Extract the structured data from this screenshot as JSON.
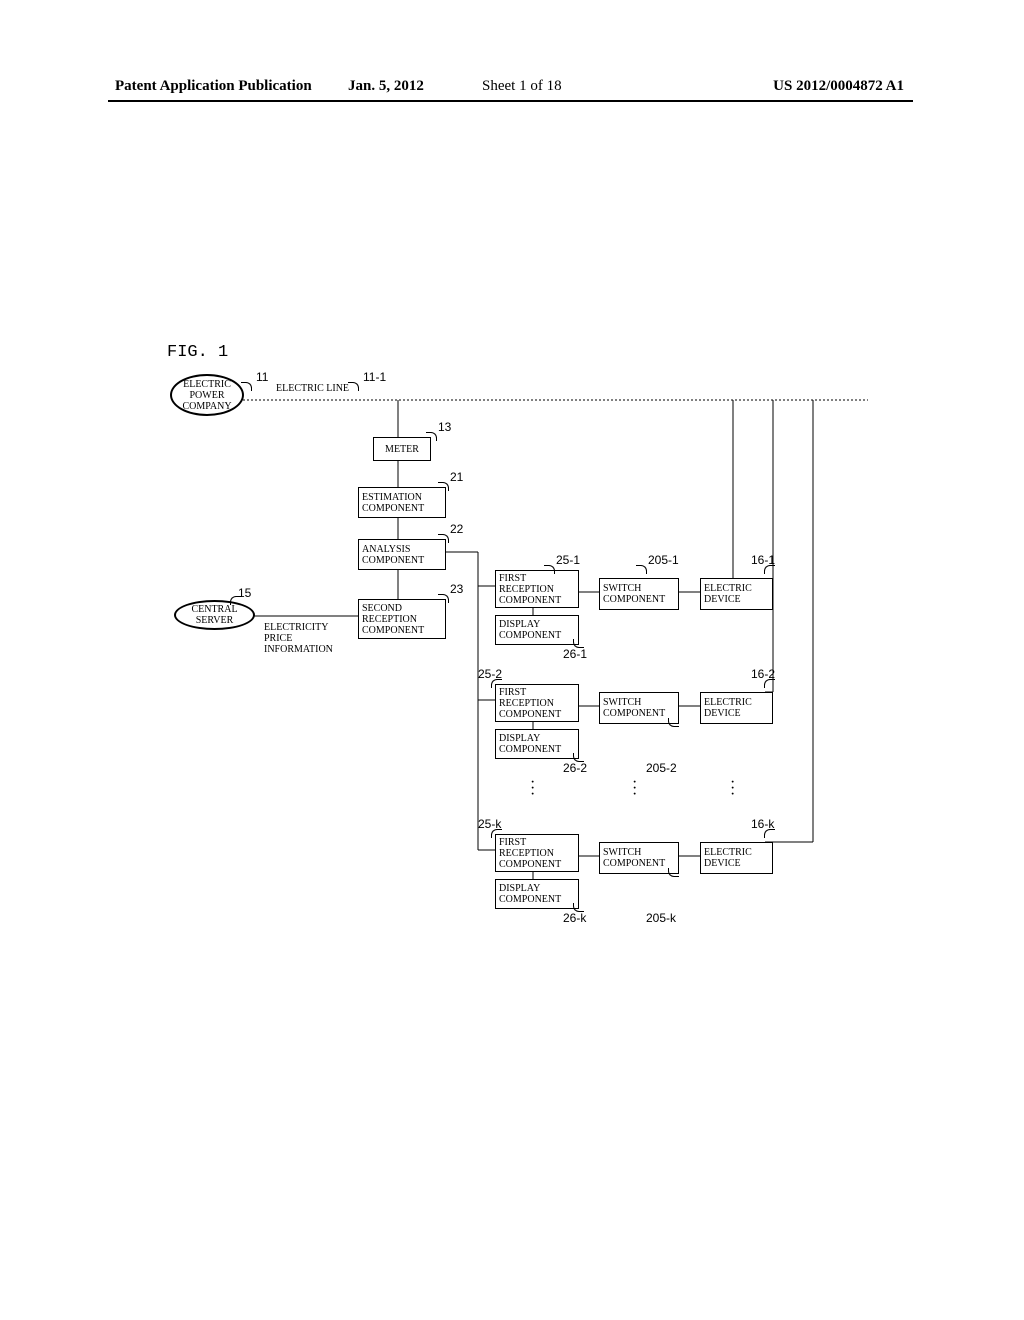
{
  "header": {
    "publication": "Patent Application Publication",
    "date": "Jan. 5, 2012",
    "sheet": "Sheet 1 of 18",
    "pubno": "US 2012/0004872 A1"
  },
  "figure_label": "FIG. 1",
  "nodes": {
    "epc": "ELECTRIC\nPOWER\nCOMPANY",
    "electric_line": "ELECTRIC LINE",
    "meter": "METER",
    "estimation": "ESTIMATION\nCOMPONENT",
    "analysis": "ANALYSIS\nCOMPONENT",
    "second_reception": "SECOND\nRECEPTION\nCOMPONENT",
    "central_server": "CENTRAL\nSERVER",
    "price_info": "ELECTRICITY\nPRICE\nINFORMATION",
    "first_reception": "FIRST\nRECEPTION\nCOMPONENT",
    "display_component": "DISPLAY\nCOMPONENT",
    "switch_component": "SWITCH\nCOMPONENT",
    "electric_device": "ELECTRIC\nDEVICE"
  },
  "refs": {
    "r11": "11",
    "r11_1": "11-1",
    "r13": "13",
    "r21": "21",
    "r22": "22",
    "r23": "23",
    "r15": "15",
    "r25_1": "25-1",
    "r205_1": "205-1",
    "r16_1": "16-1",
    "r26_1": "26-1",
    "r25_2": "25-2",
    "r26_2": "26-2",
    "r205_2": "205-2",
    "r16_2": "16-2",
    "r25_k": "25-k",
    "r26_k": "26-k",
    "r205_k": "205-k",
    "r16_k": "16-k"
  }
}
